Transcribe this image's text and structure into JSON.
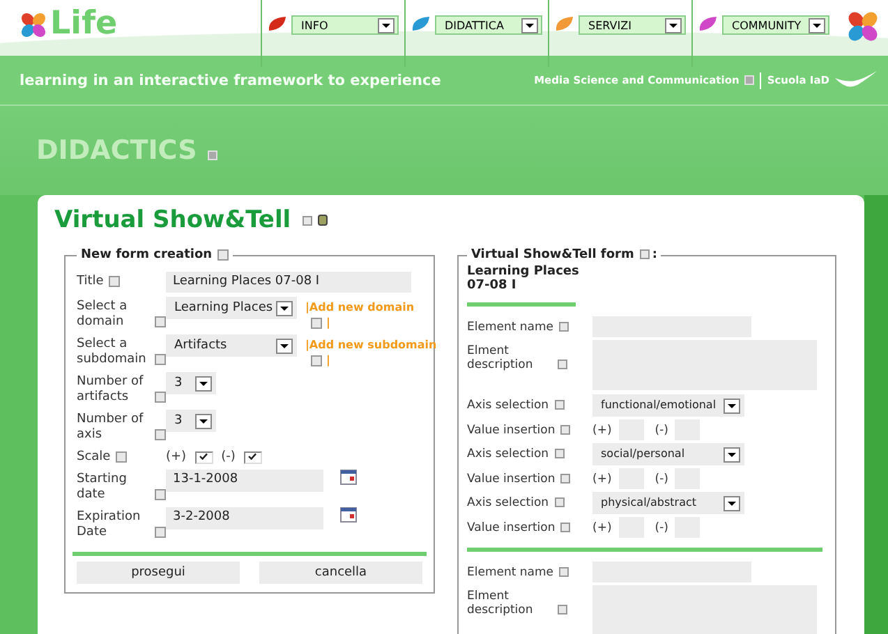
{
  "logo": {
    "text": "Life"
  },
  "nav": [
    {
      "label": "INFO",
      "color": "#d42a1a"
    },
    {
      "label": "DIDATTICA",
      "color": "#2a9ad4"
    },
    {
      "label": "SERVIZI",
      "color": "#f29a38"
    },
    {
      "label": "COMMUNITY",
      "color": "#d048c8"
    }
  ],
  "tagline": "learning in an interactive framework to experience",
  "institution": "Media Science and Communication",
  "school": "Scuola IaD",
  "section_title": "DIDACTICS",
  "page_title": "Virtual Show&Tell",
  "new_form": {
    "legend": "New form creation",
    "fields": [
      {
        "kind": "text",
        "label": "Title",
        "value": "Learning Places 07-08 I"
      },
      {
        "kind": "select",
        "label": "Select a domain",
        "value": "Learning Places",
        "link": "|Add new domain",
        "after": "|"
      },
      {
        "kind": "select",
        "label": "Select a subdomain",
        "value": "Artifacts",
        "link": "|Add new subdomain",
        "after": "|"
      },
      {
        "kind": "number",
        "label": "Number of artifacts",
        "value": "3"
      },
      {
        "kind": "number",
        "label": "Number of axis",
        "value": "3"
      },
      {
        "kind": "scale",
        "label": "Scale",
        "options": [
          {
            "label": "(+)",
            "checked": true
          },
          {
            "label": "(-)",
            "checked": true
          }
        ]
      },
      {
        "kind": "date",
        "label": "Starting date",
        "value": "13-1-2008"
      },
      {
        "kind": "date",
        "label": "Expiration Date",
        "value": "3-2-2008"
      }
    ],
    "buttons": [
      "prosegui",
      "cancella"
    ]
  },
  "element_form": {
    "legend": "Virtual Show&Tell form",
    "colon": ":",
    "heading": "Learning Places 07-08 I",
    "elements": [
      {
        "name_label": "Element name",
        "description_label": "Elment description",
        "axes": [
          {
            "label": "Axis selection",
            "value": "functional/emotional",
            "value_label": "Value insertion",
            "plus": "(+)",
            "minus": "(-)"
          },
          {
            "label": "Axis selection",
            "value": "social/personal",
            "value_label": "Value insertion",
            "plus": "(+)",
            "minus": "(-)"
          },
          {
            "label": "Axis selection",
            "value": "physical/abstract",
            "value_label": "Value insertion",
            "plus": "(+)",
            "minus": "(-)"
          }
        ]
      },
      {
        "name_label": "Element name",
        "description_label": "Elment description"
      }
    ]
  }
}
